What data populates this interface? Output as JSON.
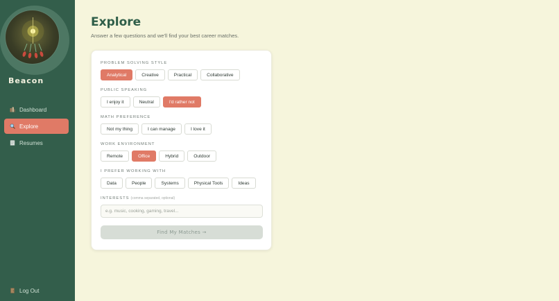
{
  "brand": {
    "name": "Beacon"
  },
  "nav": {
    "dashboard": "Dashboard",
    "explore": "Explore",
    "resumes": "Resumes",
    "logout": "Log Out"
  },
  "colors": {
    "sidebar": "#335e4b",
    "accent": "#e07a66",
    "background": "#f6f5dc",
    "title": "#2f5e49"
  },
  "icons": {
    "dashboard": "dashboard-icon",
    "explore": "search-icon",
    "resumes": "document-icon",
    "logout": "logout-icon"
  },
  "page": {
    "title": "Explore",
    "subtitle": "Answer a few questions and we'll find your best career matches."
  },
  "sections": [
    {
      "label": "Problem Solving Style",
      "options": [
        "Analytical",
        "Creative",
        "Practical",
        "Collaborative"
      ],
      "selected": "Analytical"
    },
    {
      "label": "Public Speaking",
      "options": [
        "I enjoy it",
        "Neutral",
        "I'd rather not"
      ],
      "selected": "I'd rather not"
    },
    {
      "label": "Math Preference",
      "options": [
        "Not my thing",
        "I can manage",
        "I love it"
      ],
      "selected": null
    },
    {
      "label": "Work Environment",
      "options": [
        "Remote",
        "Office",
        "Hybrid",
        "Outdoor"
      ],
      "selected": "Office"
    },
    {
      "label": "I Prefer Working With",
      "options": [
        "Data",
        "People",
        "Systems",
        "Physical Tools",
        "Ideas"
      ],
      "selected": null
    }
  ],
  "interests": {
    "label": "Interests",
    "hint": "(comma separated, optional)",
    "placeholder": "e.g. music, cooking, gaming, travel..."
  },
  "submit_label": "Find My Matches →"
}
